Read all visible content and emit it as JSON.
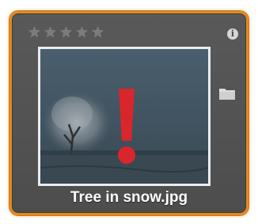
{
  "media_card": {
    "file_name": "Tree in snow.jpg",
    "rating": {
      "value": 0,
      "max": 5
    },
    "icons": {
      "info": "info-icon",
      "folder": "folder-icon",
      "warning": "exclamation-warning-icon",
      "open_external": "open-external-icon"
    },
    "colors": {
      "selection_border": "#e48a1f",
      "card_background": "#555555",
      "warning": "#d9262c"
    }
  }
}
